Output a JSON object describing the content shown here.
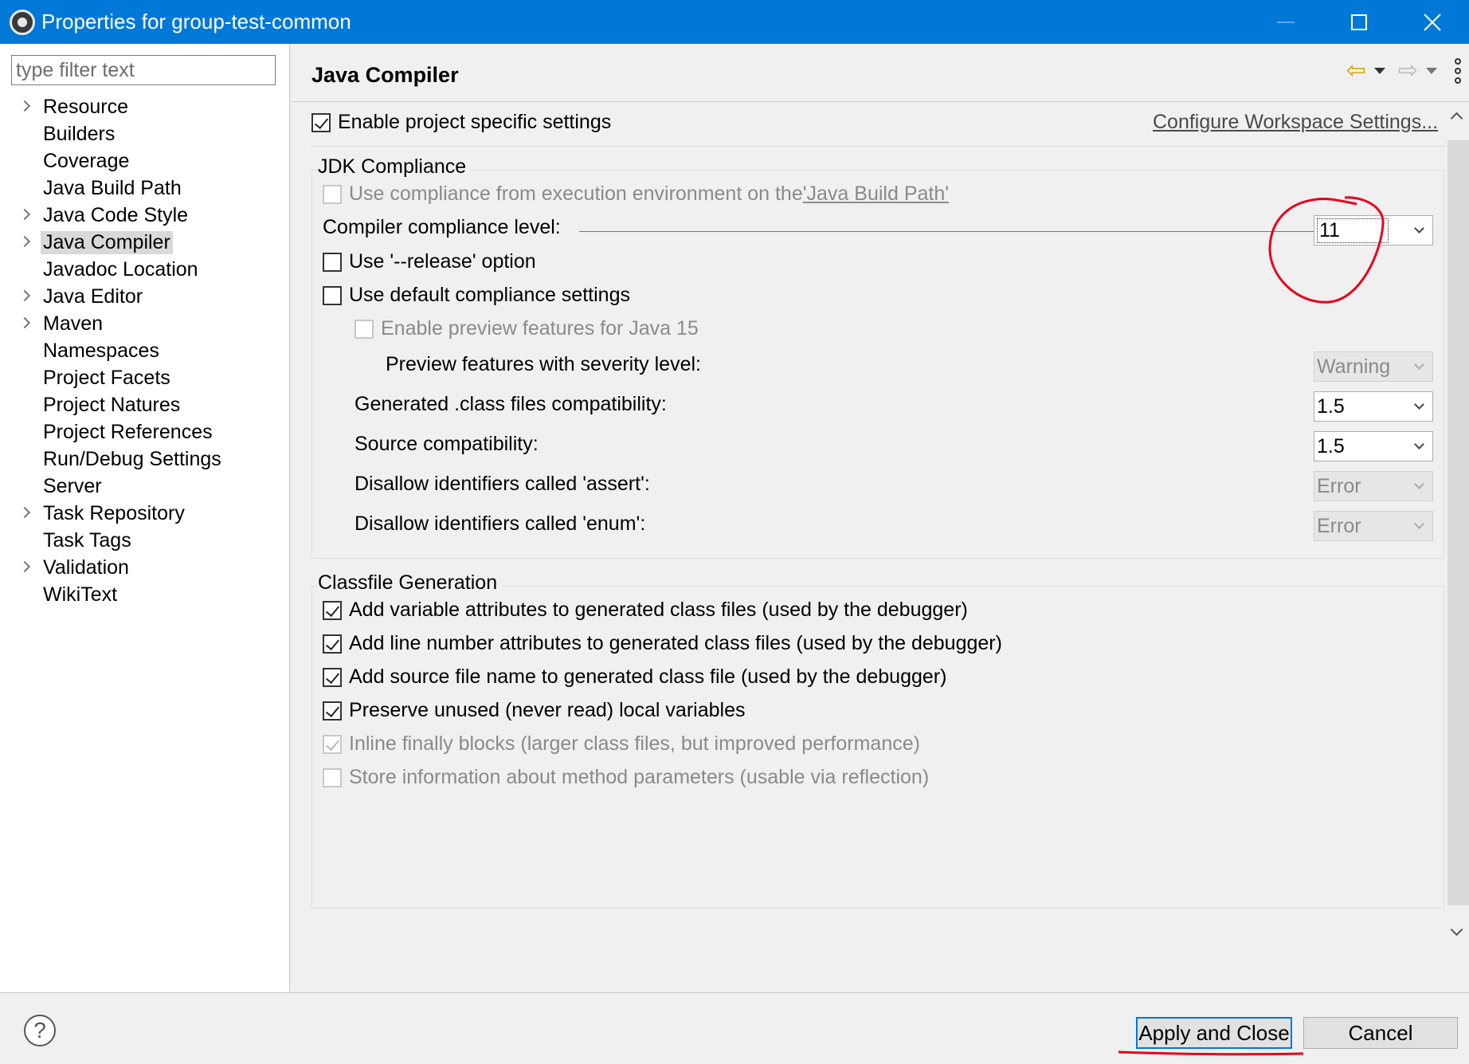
{
  "window": {
    "title": "Properties for group-test-common",
    "minimize_icon": "minimize-icon",
    "maximize_icon": "maximize-icon",
    "close_icon": "close-icon"
  },
  "sidebar": {
    "filter_placeholder": "type filter text",
    "items": [
      {
        "label": "Resource",
        "expandable": true
      },
      {
        "label": "Builders",
        "expandable": false
      },
      {
        "label": "Coverage",
        "expandable": false
      },
      {
        "label": "Java Build Path",
        "expandable": false
      },
      {
        "label": "Java Code Style",
        "expandable": true
      },
      {
        "label": "Java Compiler",
        "expandable": true,
        "selected": true
      },
      {
        "label": "Javadoc Location",
        "expandable": false
      },
      {
        "label": "Java Editor",
        "expandable": true
      },
      {
        "label": "Maven",
        "expandable": true
      },
      {
        "label": "Namespaces",
        "expandable": false
      },
      {
        "label": "Project Facets",
        "expandable": false
      },
      {
        "label": "Project Natures",
        "expandable": false
      },
      {
        "label": "Project References",
        "expandable": false
      },
      {
        "label": "Run/Debug Settings",
        "expandable": false
      },
      {
        "label": "Server",
        "expandable": false
      },
      {
        "label": "Task Repository",
        "expandable": true
      },
      {
        "label": "Task Tags",
        "expandable": false
      },
      {
        "label": "Validation",
        "expandable": true
      },
      {
        "label": "WikiText",
        "expandable": false
      }
    ]
  },
  "page": {
    "title": "Java Compiler",
    "enable_project_specific": {
      "label": "Enable project specific settings",
      "checked": true
    },
    "configure_workspace_link": "Configure Workspace Settings...",
    "jdk": {
      "group_title": "JDK Compliance",
      "use_exec_env_prefix": "Use compliance from execution environment on the ",
      "use_exec_env_link": "'Java Build Path'",
      "compliance_level_label": "Compiler compliance level:",
      "compliance_level_value": "11",
      "release_option_label": "Use '--release' option",
      "default_compliance_label": "Use default compliance settings",
      "preview_label": "Enable preview features for Java 15",
      "preview_severity_label": "Preview features with severity level:",
      "preview_severity_value": "Warning",
      "generated_class_label": "Generated .class files compatibility:",
      "generated_class_value": "1.5",
      "source_compat_label": "Source compatibility:",
      "source_compat_value": "1.5",
      "assert_label": "Disallow identifiers called 'assert':",
      "assert_value": "Error",
      "enum_label": "Disallow identifiers called 'enum':",
      "enum_value": "Error"
    },
    "classfile": {
      "group_title": "Classfile Generation",
      "options": [
        {
          "label": "Add variable attributes to generated class files (used by the debugger)",
          "checked": true,
          "disabled": false
        },
        {
          "label": "Add line number attributes to generated class files (used by the debugger)",
          "checked": true,
          "disabled": false
        },
        {
          "label": "Add source file name to generated class file (used by the debugger)",
          "checked": true,
          "disabled": false
        },
        {
          "label": "Preserve unused (never read) local variables",
          "checked": true,
          "disabled": false
        },
        {
          "label": "Inline finally blocks (larger class files, but improved performance)",
          "checked": true,
          "disabled": true
        },
        {
          "label": "Store information about method parameters (usable via reflection)",
          "checked": false,
          "disabled": true
        }
      ]
    }
  },
  "buttons": {
    "help_glyph": "?",
    "apply_close": "Apply and Close",
    "cancel": "Cancel"
  },
  "colors": {
    "titlebar": "#0078d7",
    "annotation": "#e8001c",
    "back_arrow": "#d8a200"
  }
}
